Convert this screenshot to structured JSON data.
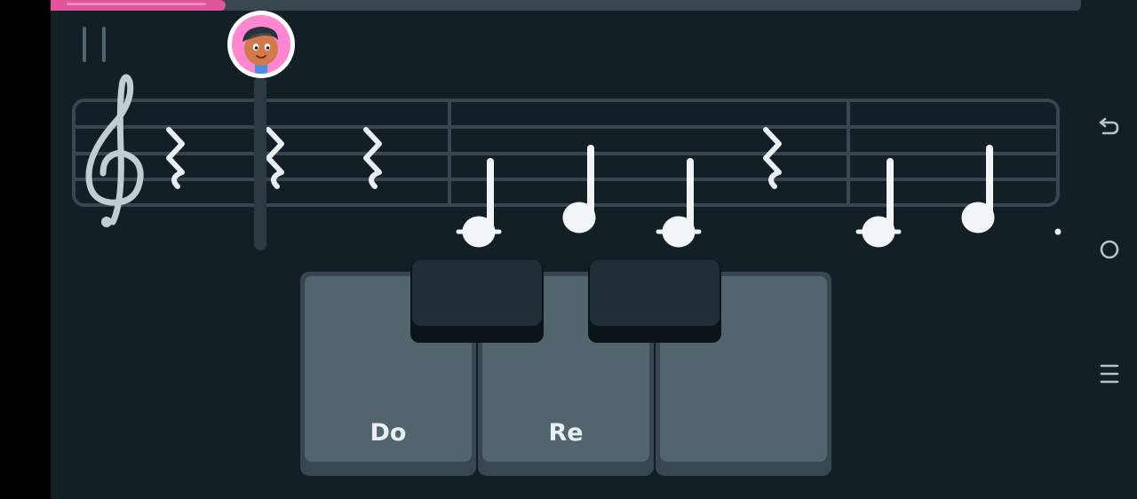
{
  "progress": {
    "value": 0.17
  },
  "colors": {
    "background": "#131f24",
    "accent": "#e0559c",
    "staff": "#37464f",
    "note": "#ffffff",
    "key_face": "#52656d"
  },
  "score": {
    "clef": "treble-clef-icon",
    "elements": [
      "rest",
      "rest",
      "rest",
      "note",
      "note",
      "note",
      "rest",
      "note",
      "note"
    ]
  },
  "keyboard": {
    "white_keys": [
      {
        "label": "Do"
      },
      {
        "label": "Re"
      },
      {
        "label": ""
      }
    ],
    "black_keys": 2
  },
  "system_nav": [
    "back-icon",
    "home-icon",
    "recents-icon"
  ]
}
